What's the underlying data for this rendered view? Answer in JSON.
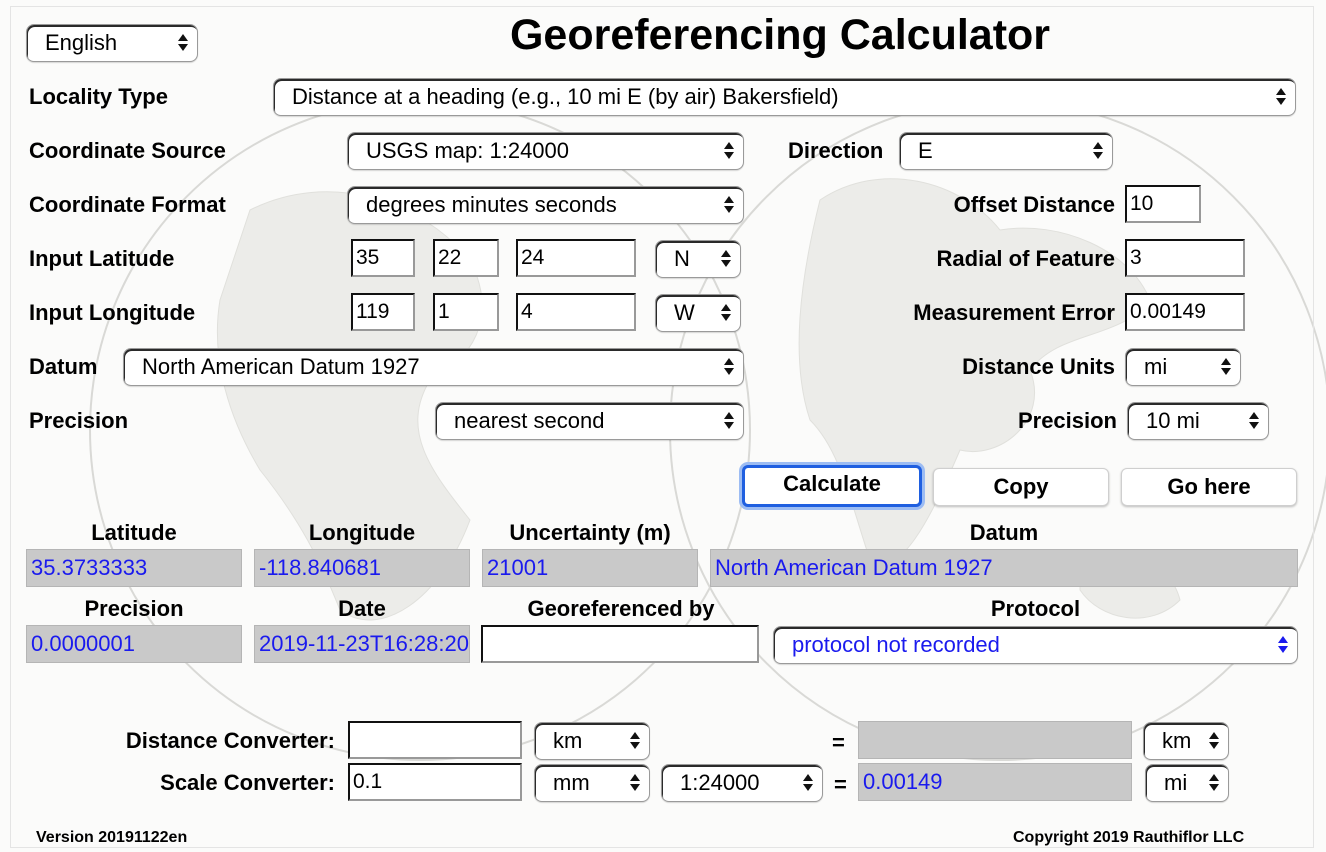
{
  "language": {
    "selected": "English"
  },
  "title": "Georeferencing Calculator",
  "locality_type": {
    "label": "Locality Type",
    "selected": "Distance at a heading (e.g., 10 mi E (by air) Bakersfield)"
  },
  "coordinate_source": {
    "label": "Coordinate Source",
    "selected": "USGS map: 1:24000"
  },
  "direction": {
    "label": "Direction",
    "selected": "E"
  },
  "coordinate_format": {
    "label": "Coordinate Format",
    "selected": "degrees minutes seconds"
  },
  "offset_distance": {
    "label": "Offset Distance",
    "value": "10"
  },
  "input_latitude": {
    "label": "Input Latitude",
    "degrees": "35",
    "minutes": "22",
    "seconds": "24",
    "hemisphere": "N"
  },
  "radial_of_feature": {
    "label": "Radial of Feature",
    "value": "3"
  },
  "input_longitude": {
    "label": "Input Longitude",
    "degrees": "119",
    "minutes": "1",
    "seconds": "4",
    "hemisphere": "W"
  },
  "measurement_error": {
    "label": "Measurement Error",
    "value": "0.00149"
  },
  "datum": {
    "label": "Datum",
    "selected": "North American Datum 1927"
  },
  "distance_units": {
    "label": "Distance Units",
    "selected": "mi"
  },
  "precision": {
    "label": "Precision",
    "selected": "nearest second"
  },
  "distance_precision": {
    "label": "Precision",
    "selected": "10 mi"
  },
  "buttons": {
    "calculate": "Calculate",
    "copy": "Copy",
    "go_here": "Go here"
  },
  "results": {
    "latitude_header": "Latitude",
    "longitude_header": "Longitude",
    "uncertainty_header": "Uncertainty (m)",
    "datum_header": "Datum",
    "latitude": "35.3733333",
    "longitude": "-118.840681",
    "uncertainty": "21001",
    "datum": "North American Datum 1927",
    "precision_header": "Precision",
    "date_header": "Date",
    "georeferenced_by_header": "Georeferenced by",
    "protocol_header": "Protocol",
    "precision": "0.0000001",
    "date": "2019-11-23T16:28:20",
    "georeferenced_by": "",
    "protocol": "protocol not recorded"
  },
  "distance_converter": {
    "label": "Distance Converter:",
    "value": "",
    "from_unit": "km",
    "equals": "=",
    "result": "",
    "to_unit": "km"
  },
  "scale_converter": {
    "label": "Scale Converter:",
    "value": "0.1",
    "from_unit": "mm",
    "scale": "1:24000",
    "equals": "=",
    "result": "0.00149",
    "to_unit": "mi"
  },
  "footer": {
    "version": "Version 20191122en",
    "copyright": "Copyright 2019 Rauthiflor LLC"
  },
  "colors": {
    "output_text": "#1a1aee",
    "output_bg": "#c9c9c9",
    "focus_ring": "#1f5fe0"
  }
}
